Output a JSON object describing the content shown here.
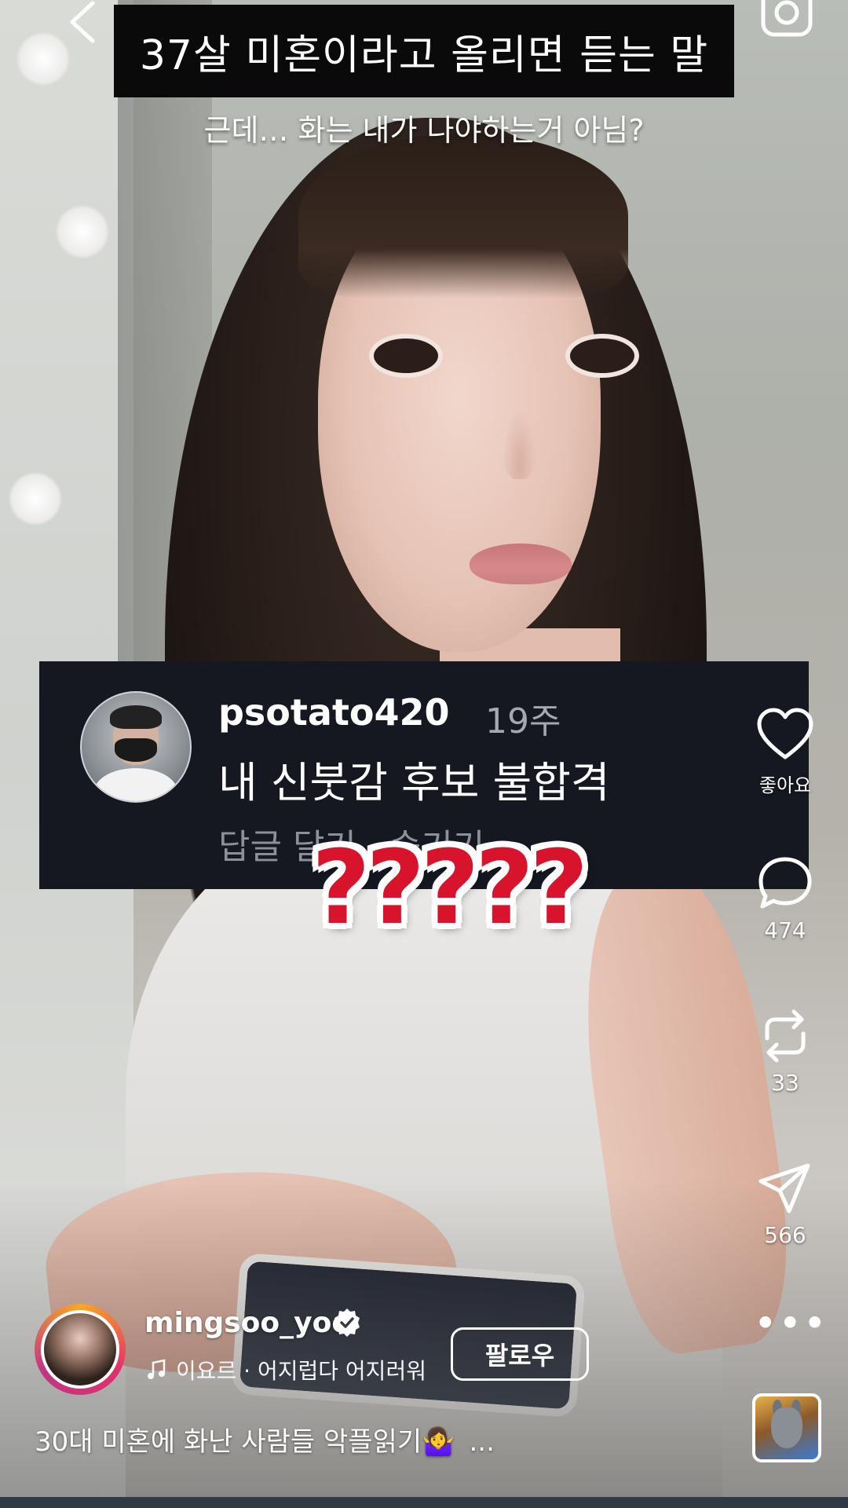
{
  "overlay": {
    "title": "37살 미혼이라고 올리면 듣는 말",
    "subtitle": "근데… 화는 내가 나야하는거 아님?"
  },
  "comment": {
    "username": "psotato420",
    "time": "19주",
    "text": "내 신붓감 후보 불합격",
    "actions": "답글 달기 · 숨기기"
  },
  "sticker_text": "?????",
  "rail": {
    "like_label": "좋아요",
    "comments": "474",
    "reposts": "33",
    "shares": "566"
  },
  "author": {
    "username": "mingsoo_yoo",
    "audio": "이요르 · 어지럽다 어지러워",
    "follow_label": "팔로우"
  },
  "caption": {
    "text": "30대 미혼에 화난 사람들 악플읽기🤷‍♀️",
    "more": "..."
  },
  "colors": {
    "sticker": "#d8142c",
    "comment_bg": "#151821",
    "banner_bg": "#0a0a0a"
  },
  "icons": [
    "back-arrow-icon",
    "camera-icon",
    "heart-icon",
    "comment-icon",
    "repost-icon",
    "send-icon",
    "more-icon",
    "verified-icon",
    "music-note-icon"
  ]
}
